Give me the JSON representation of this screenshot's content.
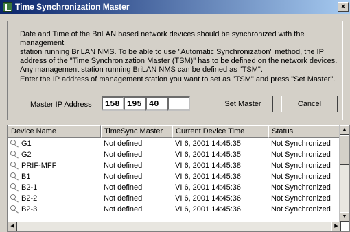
{
  "window": {
    "title": "Time Synchronization Master",
    "close_label": "×"
  },
  "description": {
    "line1": "Date and Time of the BriLAN based network devices should be synchronized with the management",
    "line2": "station running BriLAN NMS. To be able to use \"Automatic Synchronization\"   method, the IP",
    "line3": "address of the \"Time  Synchronization Master (TSM)\" has to be defined on  the network devices.",
    "line4": "Any management station running BriLAN NMS can be defined as \"TSM\"."
  },
  "instruction": "Enter the IP address of management station you want to set as \"TSM\" and press   \"Set Master\".",
  "ip": {
    "label": "Master IP Address",
    "octets": [
      "158",
      "195",
      "40",
      ""
    ]
  },
  "buttons": {
    "set_master": "Set Master",
    "cancel": "Cancel"
  },
  "table": {
    "columns": [
      "Device Name",
      "TimeSync Master",
      "Current Device Time",
      "Status"
    ],
    "rows": [
      {
        "name": "G1",
        "master": "Not defined",
        "time": "VI 6, 2001  14:45:35",
        "status": "Not Synchronized"
      },
      {
        "name": "G2",
        "master": "Not defined",
        "time": "VI 6, 2001  14:45:35",
        "status": "Not Synchronized"
      },
      {
        "name": "PRIF-MFF",
        "master": "Not defined",
        "time": "VI 6, 2001  14:45:38",
        "status": "Not Synchronized"
      },
      {
        "name": "B1",
        "master": "Not defined",
        "time": "VI 6, 2001  14:45:36",
        "status": "Not Synchronized"
      },
      {
        "name": "B2-1",
        "master": "Not defined",
        "time": "VI 6, 2001  14:45:36",
        "status": "Not Synchronized"
      },
      {
        "name": "B2-2",
        "master": "Not defined",
        "time": "VI 6, 2001  14:45:36",
        "status": "Not Synchronized"
      },
      {
        "name": "B2-3",
        "master": "Not defined",
        "time": "VI 6, 2001  14:45:36",
        "status": "Not Synchronized"
      }
    ]
  },
  "icons": {
    "device": "key-icon",
    "app": "app-icon"
  }
}
